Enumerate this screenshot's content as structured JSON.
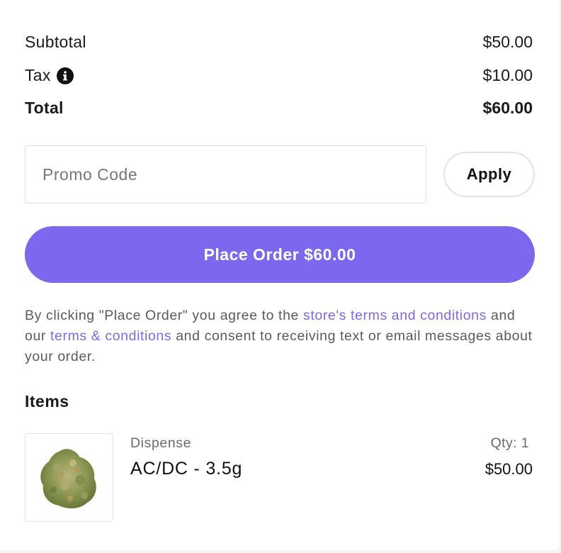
{
  "summary": {
    "subtotal_label": "Subtotal",
    "subtotal_value": "$50.00",
    "tax_label": "Tax",
    "tax_value": "$10.00",
    "total_label": "Total",
    "total_value": "$60.00",
    "tax_icon": "info-icon"
  },
  "promo": {
    "placeholder": "Promo Code",
    "value": "",
    "apply_label": "Apply"
  },
  "checkout": {
    "place_order_label": "Place Order $60.00",
    "accent_color": "#7b68ee"
  },
  "legal": {
    "prefix": "By clicking \"Place Order\" you agree to the ",
    "store_terms_link": "store's terms and conditions",
    "middle": " and our ",
    "terms_link": "terms & conditions",
    "suffix": " and consent to receiving text or email messages about your order."
  },
  "items": {
    "heading": "Items",
    "list": [
      {
        "brand": "Dispense",
        "name": "AC/DC - 3.5g",
        "qty": "Qty: 1",
        "price": "$50.00",
        "image_icon": "cannabis-flower-image"
      }
    ]
  }
}
